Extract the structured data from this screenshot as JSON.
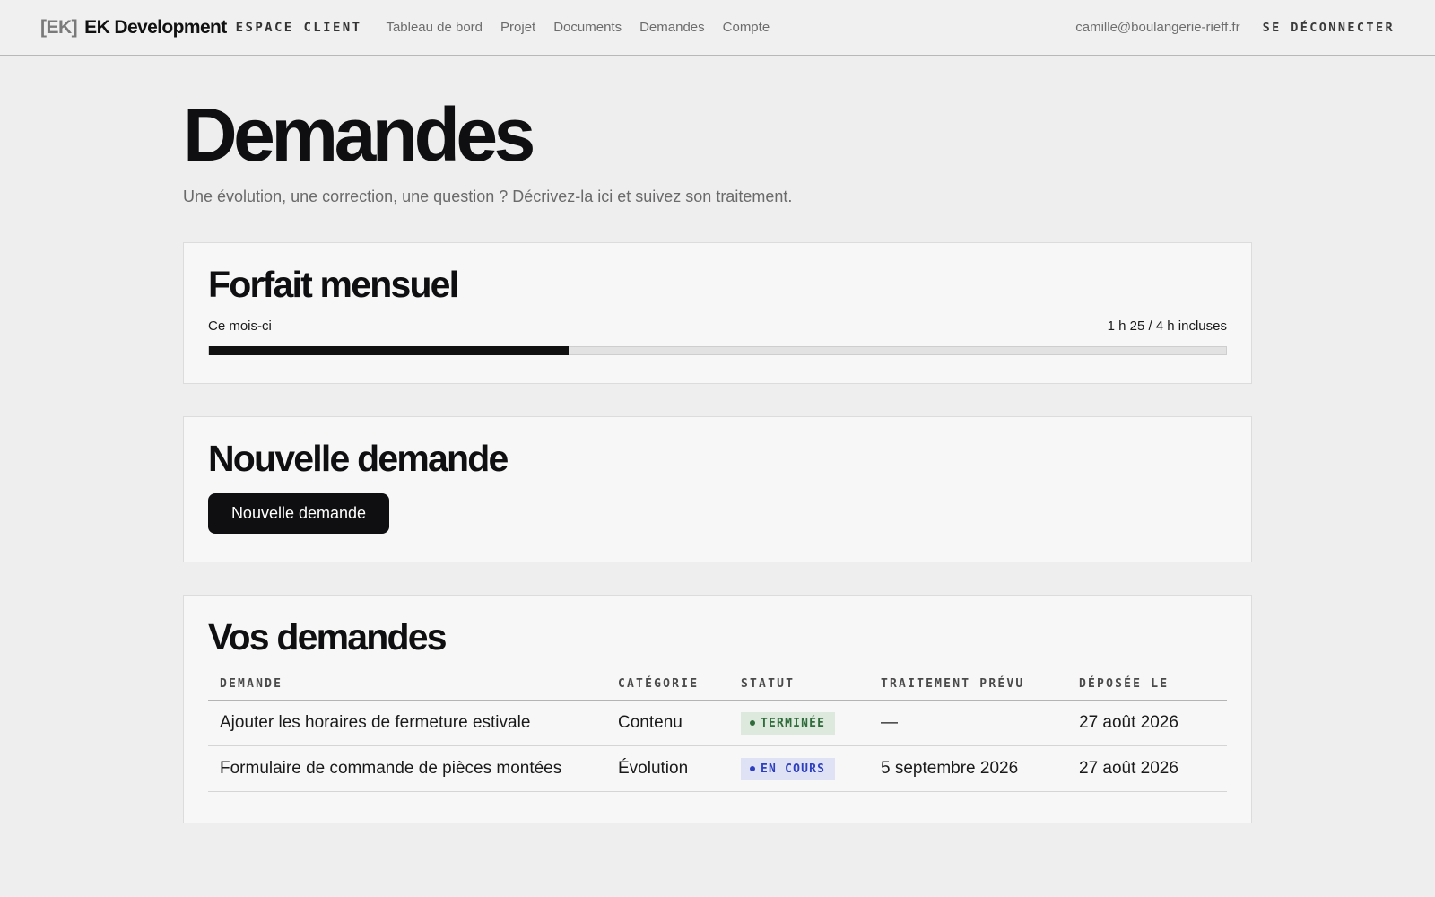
{
  "header": {
    "brand_mark": "[EK]",
    "brand_name": "EK Development",
    "brand_sub": "ESPACE CLIENT",
    "nav": [
      "Tableau de bord",
      "Projet",
      "Documents",
      "Demandes",
      "Compte"
    ],
    "user_email": "camille@boulangerie-rieff.fr",
    "logout_label": "SE DÉCONNECTER"
  },
  "page": {
    "title": "Demandes",
    "subtitle": "Une évolution, une correction, une question ? Décrivez-la ici et suivez son traitement."
  },
  "plan": {
    "title": "Forfait mensuel",
    "period_label": "Ce mois-ci",
    "usage_text": "1 h 25 / 4 h incluses",
    "used_fraction": 0.354
  },
  "new_request": {
    "title": "Nouvelle demande",
    "button_label": "Nouvelle demande"
  },
  "requests": {
    "title": "Vos demandes",
    "columns": [
      "DEMANDE",
      "CATÉGORIE",
      "STATUT",
      "TRAITEMENT PRÉVU",
      "DÉPOSÉE LE"
    ],
    "rows": [
      {
        "demande": "Ajouter les horaires de fermeture estivale",
        "categorie": "Contenu",
        "statut": "TERMINÉE",
        "traitement": "—",
        "deposee": "27 août 2026"
      },
      {
        "demande": "Formulaire de commande de pièces montées",
        "categorie": "Évolution",
        "statut": "EN COURS",
        "traitement": "5 septembre 2026",
        "deposee": "27 août 2026"
      }
    ]
  },
  "colors": {
    "status_done_bg": "#dde9dc",
    "status_done_fg": "#2f6b3b",
    "status_progress_bg": "#dfe2f5",
    "status_progress_fg": "#2d3fc0"
  }
}
